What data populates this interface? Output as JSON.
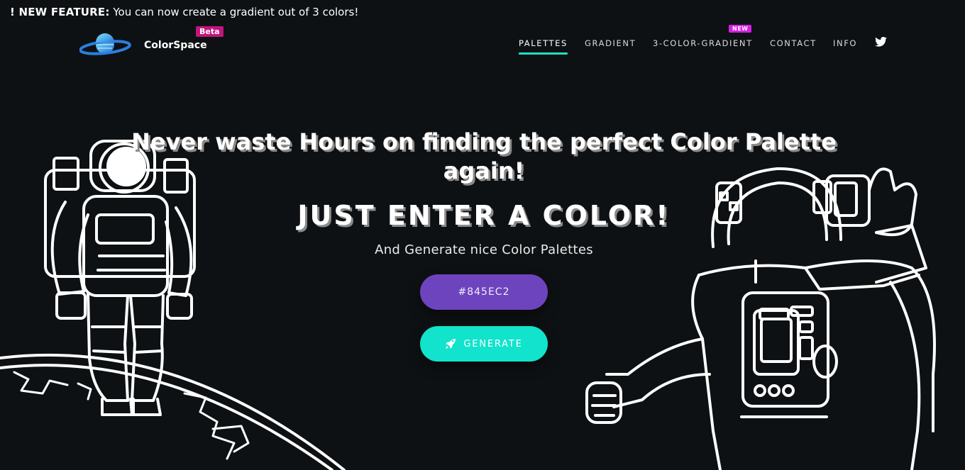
{
  "announcement": {
    "prefix": "! NEW FEATURE:",
    "text": " You can now create a gradient out of 3 colors!"
  },
  "brand": {
    "name": "ColorSpace",
    "badge": "Beta",
    "logo_icon": "planet-icon"
  },
  "nav": {
    "items": [
      {
        "label": "PALETTES",
        "active": true
      },
      {
        "label": "GRADIENT",
        "active": false
      },
      {
        "label": "3-COLOR-GRADIENT",
        "active": false,
        "badge": "NEW"
      },
      {
        "label": "CONTACT",
        "active": false
      },
      {
        "label": "INFO",
        "active": false
      }
    ],
    "social_icon": "twitter-icon"
  },
  "hero": {
    "title": "Never waste Hours on finding the perfect Color Palette again!",
    "subtitle": "JUST ENTER A COLOR!",
    "tagline": "And Generate nice Color Palettes"
  },
  "form": {
    "color_value": "#845EC2",
    "generate_label": "GENERATE",
    "generate_icon": "rocket-icon"
  },
  "colors": {
    "background": "#0e1113",
    "accent": "#22dfc4",
    "input_bg": "#6d44bd",
    "button_bg": "#12e3cc",
    "beta_badge": "#c2157d",
    "new_badge": "#d61fe4"
  },
  "illustrations": [
    "astronaut-on-planet",
    "astronaut-waving"
  ]
}
